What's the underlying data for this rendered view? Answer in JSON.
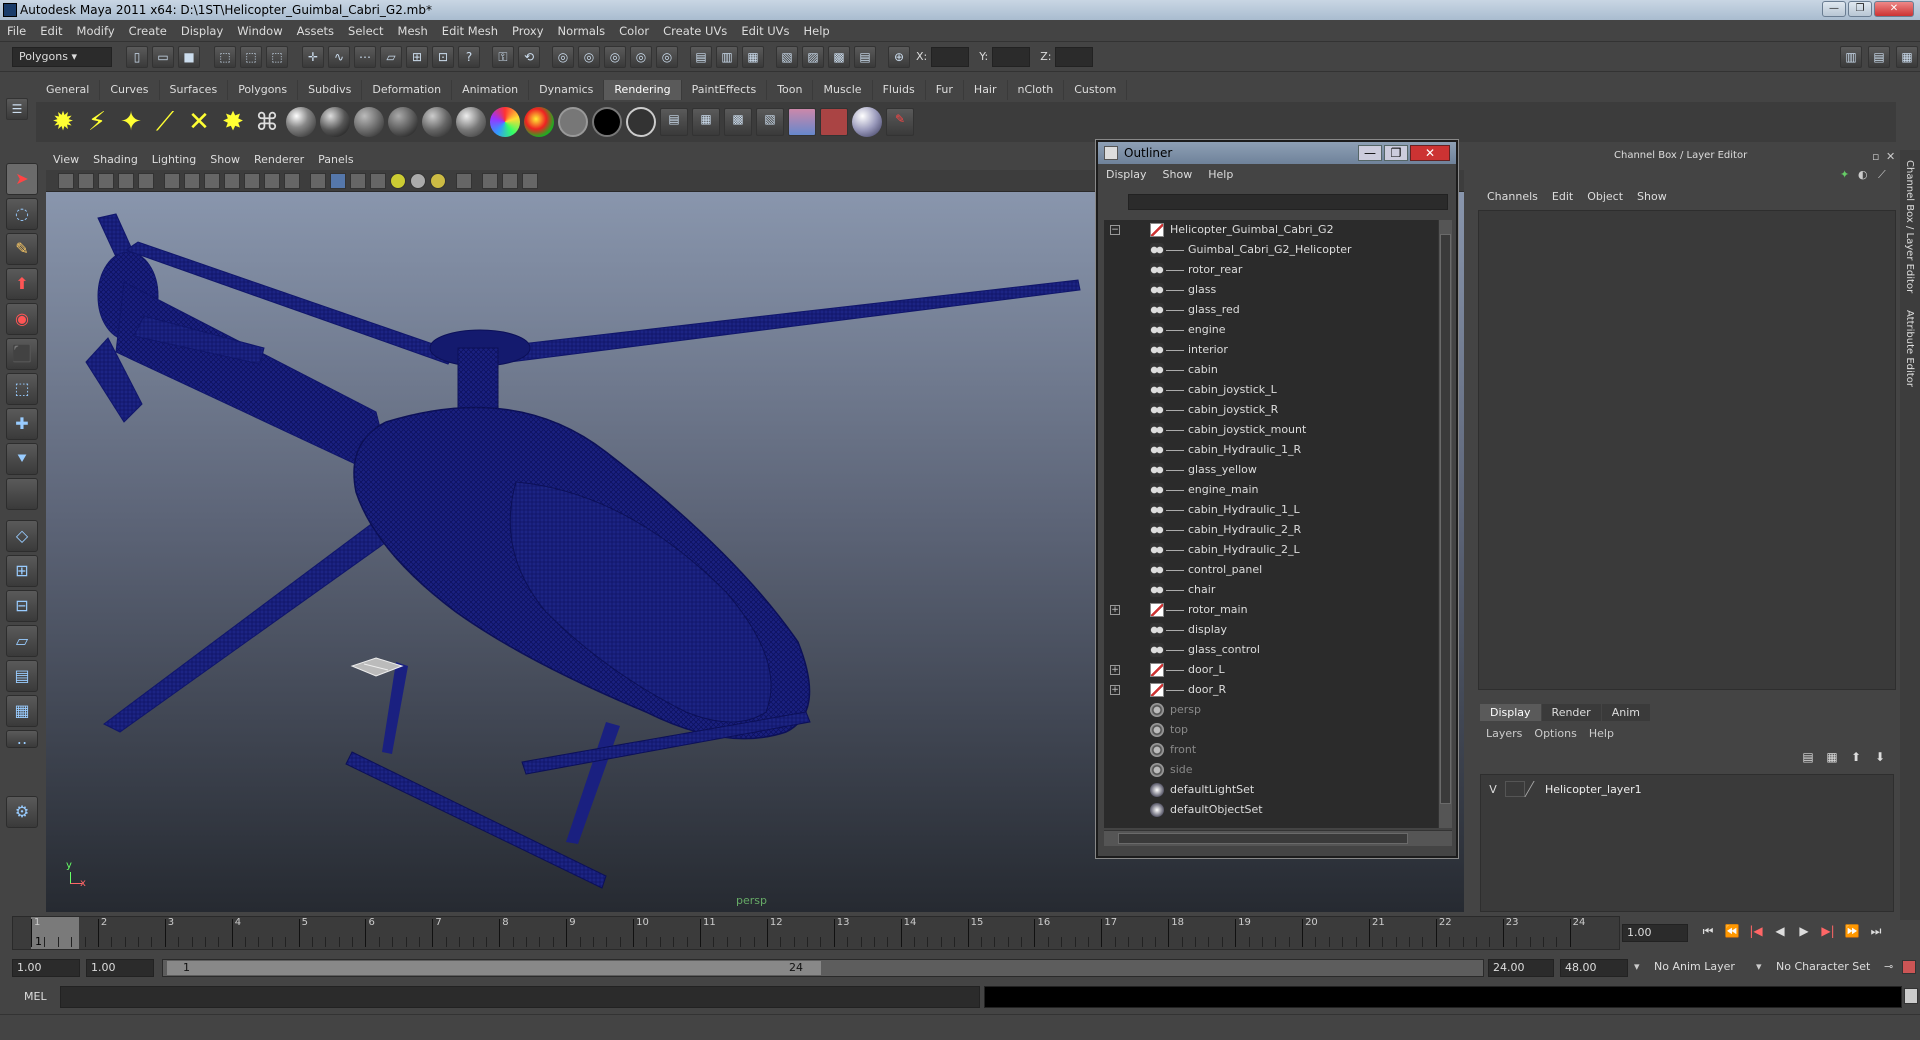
{
  "window": {
    "title": "Autodesk Maya 2011 x64: D:\\1ST\\Helicopter_Guimbal_Cabri_G2.mb*",
    "buttons": [
      "—",
      "❐",
      "✕"
    ]
  },
  "menubar": [
    "File",
    "Edit",
    "Modify",
    "Create",
    "Display",
    "Window",
    "Assets",
    "Select",
    "Mesh",
    "Edit Mesh",
    "Proxy",
    "Normals",
    "Color",
    "Create UVs",
    "Edit UVs",
    "Help"
  ],
  "statusline": {
    "mode": "Polygons",
    "x_label": "X:",
    "y_label": "Y:",
    "z_label": "Z:"
  },
  "shelf_tabs": [
    "General",
    "Curves",
    "Surfaces",
    "Polygons",
    "Subdivs",
    "Deformation",
    "Animation",
    "Dynamics",
    "Rendering",
    "PaintEffects",
    "Toon",
    "Muscle",
    "Fluids",
    "Fur",
    "Hair",
    "nCloth",
    "Custom"
  ],
  "shelf_active": "Rendering",
  "viewport": {
    "menu": [
      "View",
      "Shading",
      "Lighting",
      "Show",
      "Renderer",
      "Panels"
    ],
    "camera_label": "persp",
    "axis_x": "x",
    "axis_y": "y"
  },
  "outliner": {
    "title": "Outliner",
    "menu": [
      "Display",
      "Show",
      "Help"
    ],
    "root": "Helicopter_Guimbal_Cabri_G2",
    "children": [
      "Guimbal_Cabri_G2_Helicopter",
      "rotor_rear",
      "glass",
      "glass_red",
      "engine",
      "interior",
      "cabin",
      "cabin_joystick_L",
      "cabin_joystick_R",
      "cabin_joystick_mount",
      "cabin_Hydraulic_1_R",
      "glass_yellow",
      "engine_main",
      "cabin_Hydraulic_1_L",
      "cabin_Hydraulic_2_R",
      "cabin_Hydraulic_2_L",
      "control_panel",
      "chair",
      "rotor_main",
      "display",
      "glass_control",
      "door_L",
      "door_R"
    ],
    "expandable_children": [
      "rotor_main",
      "door_L",
      "door_R"
    ],
    "cameras": [
      "persp",
      "top",
      "front",
      "side"
    ],
    "sets": [
      "defaultLightSet",
      "defaultObjectSet"
    ]
  },
  "channel_box": {
    "title": "Channel Box / Layer Editor",
    "menu": [
      "Channels",
      "Edit",
      "Object",
      "Show"
    ]
  },
  "layer_editor": {
    "tabs": [
      "Display",
      "Render",
      "Anim"
    ],
    "active_tab": "Display",
    "menu": [
      "Layers",
      "Options",
      "Help"
    ],
    "layer": {
      "visible": "V",
      "name": "Helicopter_layer1"
    }
  },
  "side_tabs": [
    "Channel Box / Layer Editor",
    "Attribute Editor"
  ],
  "timeline": {
    "ticks": [
      "1",
      "2",
      "3",
      "4",
      "5",
      "6",
      "7",
      "8",
      "9",
      "10",
      "11",
      "12",
      "13",
      "14",
      "15",
      "16",
      "17",
      "18",
      "19",
      "20",
      "21",
      "22",
      "23",
      "24"
    ],
    "current_frame": "1",
    "current_time": "1.00"
  },
  "range": {
    "start": "1.00",
    "anim_start": "1.00",
    "range_start": "1",
    "range_end": "24",
    "anim_end": "24.00",
    "end": "48.00",
    "anim_layer": "No Anim Layer",
    "char_set": "No Character Set"
  },
  "command_line": {
    "label": "MEL"
  },
  "colors": {
    "wire": "#151b6e",
    "bg_top": "#8996ad",
    "bg_bottom": "#262a31"
  }
}
